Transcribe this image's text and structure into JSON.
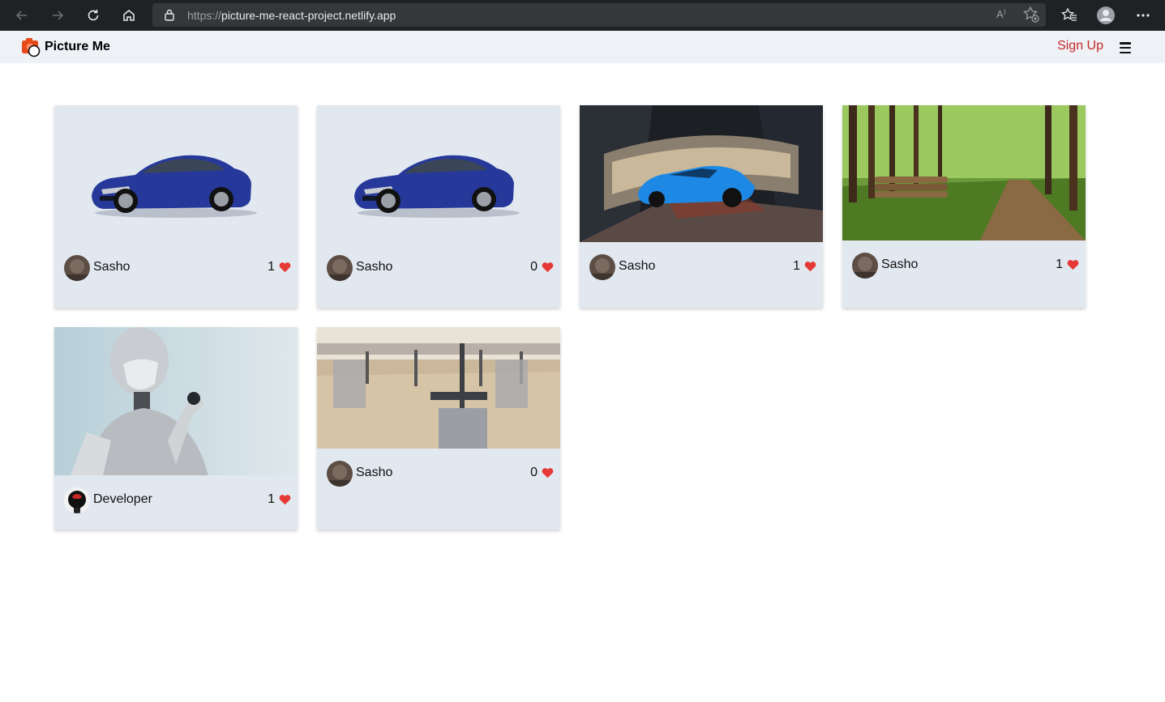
{
  "browser": {
    "url_scheme": "https://",
    "url_host": "picture-me-react-project.netlify.app"
  },
  "header": {
    "brand": "Picture Me",
    "signup_label": "Sign Up"
  },
  "colors": {
    "accent": "#c62828",
    "heart": "#e53935",
    "card_bg": "#e2e8f0",
    "header_bg": "#eef1f6"
  },
  "posts": [
    {
      "image": "blue-sedan-car",
      "author": "Sasho",
      "likes": "1"
    },
    {
      "image": "blue-sedan-car",
      "author": "Sasho",
      "likes": "0"
    },
    {
      "image": "blue-sports-car-tunnel",
      "author": "Sasho",
      "likes": "1"
    },
    {
      "image": "forest-path",
      "author": "Sasho",
      "likes": "1"
    },
    {
      "image": "humanoid-robot",
      "author": "Developer",
      "likes": "1"
    },
    {
      "image": "gym-equipment",
      "author": "Sasho",
      "likes": "0"
    }
  ]
}
